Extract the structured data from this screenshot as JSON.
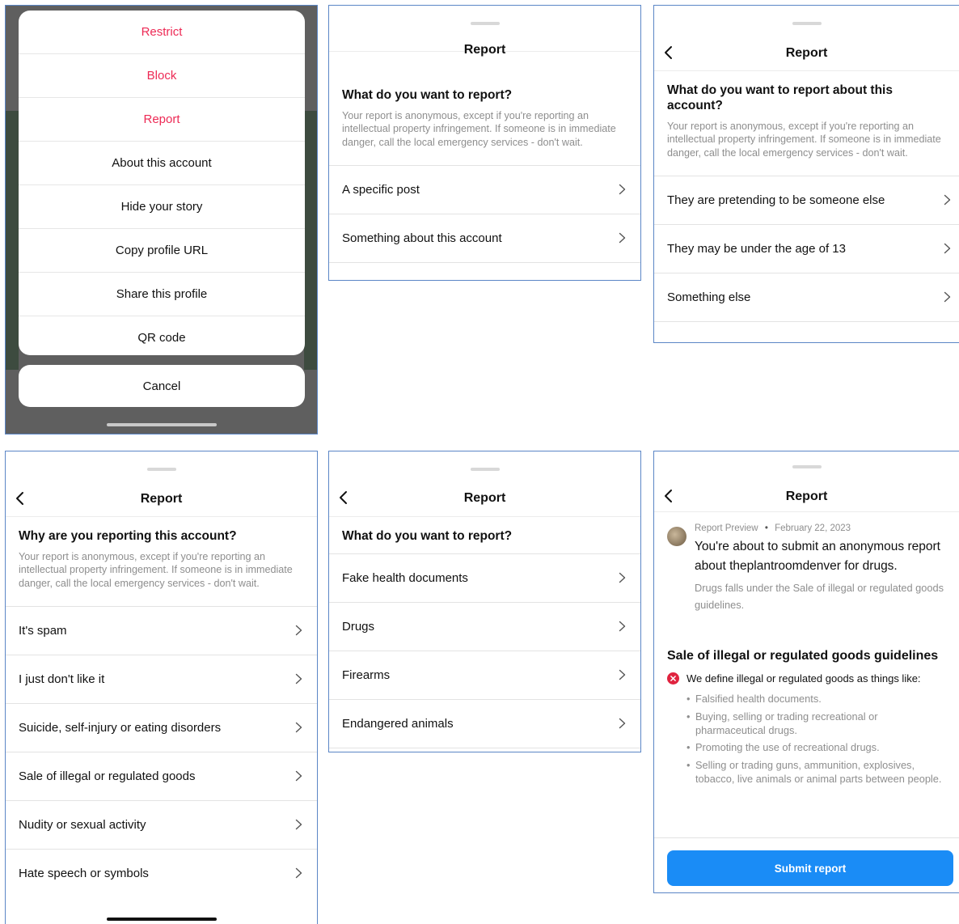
{
  "colors": {
    "destructive": "#ed2a55",
    "primary_button": "#1a8cf6",
    "muted_text": "#8e8e8e",
    "error_icon": "#e0233f"
  },
  "panel1": {
    "menu_items": [
      {
        "label": "Restrict",
        "destructive": true
      },
      {
        "label": "Block",
        "destructive": true
      },
      {
        "label": "Report",
        "destructive": true
      },
      {
        "label": "About this account",
        "destructive": false
      },
      {
        "label": "Hide your story",
        "destructive": false
      },
      {
        "label": "Copy profile URL",
        "destructive": false
      },
      {
        "label": "Share this profile",
        "destructive": false
      },
      {
        "label": "QR code",
        "destructive": false
      }
    ],
    "cancel_label": "Cancel"
  },
  "panel2": {
    "title": "Report",
    "question": "What do you want to report?",
    "note": "Your report is anonymous, except if you're reporting an intellectual property infringement. If someone is in immediate danger, call the local emergency services - don't wait.",
    "options": [
      "A specific post",
      "Something about this account"
    ]
  },
  "panel3": {
    "title": "Report",
    "question": "What do you want to report about this account?",
    "note": "Your report is anonymous, except if you're reporting an intellectual property infringement. If someone is in immediate danger, call the local emergency services - don't wait.",
    "options": [
      "They are pretending to be someone else",
      "They may be under the age of 13",
      "Something else"
    ]
  },
  "panel4": {
    "title": "Report",
    "question": "Why are you reporting this account?",
    "note": "Your report is anonymous, except if you're reporting an intellectual property infringement. If someone is in immediate danger, call the local emergency services - don't wait.",
    "options": [
      "It's spam",
      "I just don't like it",
      "Suicide, self-injury or eating disorders",
      "Sale of illegal or regulated goods",
      "Nudity or sexual activity",
      "Hate speech or symbols"
    ]
  },
  "panel5": {
    "title": "Report",
    "question": "What do you want to report?",
    "options": [
      "Fake health documents",
      "Drugs",
      "Firearms",
      "Endangered animals"
    ]
  },
  "panel6": {
    "title": "Report",
    "preview_label": "Report Preview",
    "separator": "•",
    "preview_date": "February 22, 2023",
    "preview_main": "You're about to submit an anonymous report about theplantroomdenver for drugs.",
    "preview_sub": "Drugs falls under the Sale of illegal or regulated goods guidelines.",
    "guidelines_title": "Sale of illegal or regulated goods guidelines",
    "define_text": "We define illegal or regulated goods as things like:",
    "bullets": [
      "Falsified health documents.",
      "Buying, selling or trading recreational or pharmaceutical drugs.",
      "Promoting the use of recreational drugs.",
      "Selling or trading guns, ammunition, explosives, tobacco, live animals or animal parts between people."
    ],
    "submit_label": "Submit report"
  }
}
